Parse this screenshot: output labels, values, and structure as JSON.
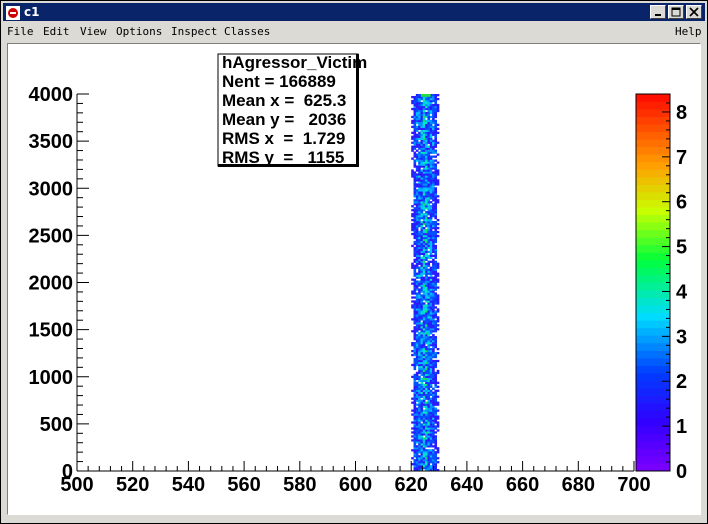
{
  "window": {
    "title": "c1"
  },
  "menubar": {
    "items": [
      "File",
      "Edit",
      "View",
      "Options",
      "Inspect",
      "Classes"
    ],
    "help": "Help"
  },
  "stats_box": {
    "title": "hAgressor_Victim",
    "lines": [
      "Nent = 166889",
      "Mean x =  625.3",
      "Mean y =   2036",
      "RMS x  =  1.729",
      "RMS y  =   1155"
    ]
  },
  "chart_data": {
    "type": "heatmap",
    "title": "hAgressor_Victim",
    "xlabel": "",
    "ylabel": "",
    "xlim": [
      500,
      700
    ],
    "ylim": [
      0,
      4000
    ],
    "x_ticks": [
      500,
      520,
      540,
      560,
      580,
      600,
      620,
      640,
      660,
      680,
      700
    ],
    "y_ticks": [
      0,
      500,
      1000,
      1500,
      2000,
      2500,
      3000,
      3500,
      4000
    ],
    "z_ticks": [
      0,
      1,
      2,
      3,
      4,
      5,
      6,
      7,
      8
    ],
    "zlim": [
      0,
      8.4
    ],
    "populated_x_range": [
      620,
      630
    ],
    "populated_y_range": [
      0,
      4000
    ],
    "entries": 166889,
    "mean_x": 625.3,
    "mean_y": 2036,
    "rms_x": 1.729,
    "rms_y": 1155
  }
}
